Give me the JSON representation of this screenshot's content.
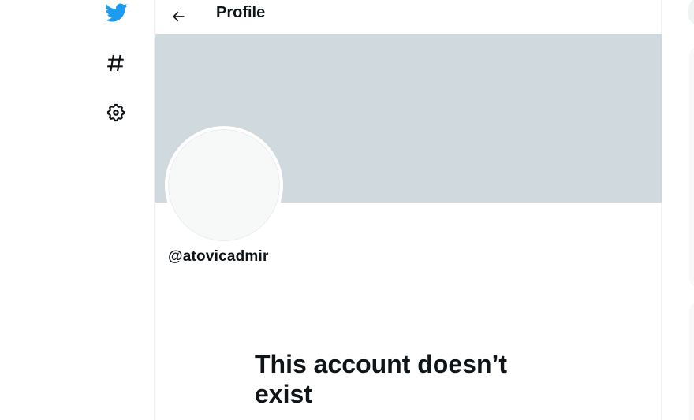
{
  "header": {
    "title": "Profile",
    "back_icon": "arrow-left-icon"
  },
  "nav": {
    "items": [
      {
        "icon": "twitter-bird-icon",
        "color": "#1d9bf0"
      },
      {
        "icon": "hashtag-icon"
      },
      {
        "icon": "gear-icon"
      }
    ]
  },
  "profile": {
    "handle": "@atovicadmir",
    "banner_color": "#cfd9de",
    "avatar_color": "#f7f9f9"
  },
  "empty_state": {
    "title": "This account doesn’t exist"
  }
}
